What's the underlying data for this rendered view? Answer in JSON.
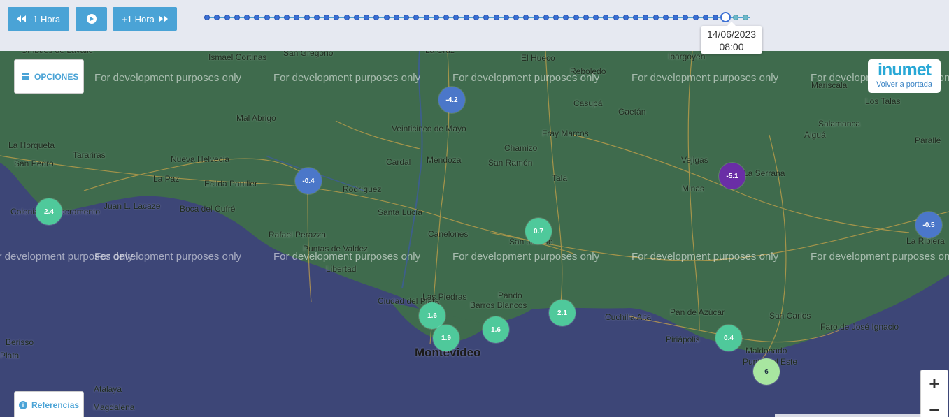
{
  "controls": {
    "prev_label": "-1 Hora",
    "next_label": "+1 Hora",
    "play_icon": "play-icon"
  },
  "timeline": {
    "date": "14/06/2023",
    "time": "08:00",
    "steps_total": 55,
    "current_step": 52
  },
  "menu": {
    "options_label": "OPCIONES",
    "references_label": "Referencias"
  },
  "logo": {
    "brand": "inumet",
    "link": "Volver a portada"
  },
  "zoom": {
    "in": "+",
    "out": "−"
  },
  "watermark": "For development purposes only",
  "colors": {
    "land": "#3f6b4d",
    "water": "#3d4677",
    "accent": "#4aa3d6",
    "marker_cold_blue": "#4b77c9",
    "marker_purple": "#6a2ea6",
    "marker_teal": "#4fc99b",
    "marker_lightgreen": "#a8e6a0"
  },
  "places": [
    {
      "name": "Ombúes de Lavalle"
    },
    {
      "name": "Ismael Cortinas"
    },
    {
      "name": "San Gregorio"
    },
    {
      "name": "La Cruz"
    },
    {
      "name": "El Hueco"
    },
    {
      "name": "Reboledo"
    },
    {
      "name": "Ibargoyen"
    },
    {
      "name": "Mariscala"
    },
    {
      "name": "Los Talas"
    },
    {
      "name": "Mal Abrigo"
    },
    {
      "name": "Casupá"
    },
    {
      "name": "Gaetán"
    },
    {
      "name": "Salamanca"
    },
    {
      "name": "Aiguá"
    },
    {
      "name": "Veinticinco de Mayo"
    },
    {
      "name": "La Horqueta"
    },
    {
      "name": "Tarariras"
    },
    {
      "name": "Nueva Helvecia"
    },
    {
      "name": "Chamizo"
    },
    {
      "name": "Fray Marcos"
    },
    {
      "name": "Parallé"
    },
    {
      "name": "San Pedro"
    },
    {
      "name": "Cardal"
    },
    {
      "name": "Mendoza"
    },
    {
      "name": "San Ramón"
    },
    {
      "name": "Vejigas"
    },
    {
      "name": "La Paz"
    },
    {
      "name": "Ecilda Paullier"
    },
    {
      "name": "Tala"
    },
    {
      "name": "La Serrana"
    },
    {
      "name": "Rodríguez"
    },
    {
      "name": "Minas"
    },
    {
      "name": "Juan L. Lacaze"
    },
    {
      "name": "Boca del Cufré"
    },
    {
      "name": "Santa Lucía"
    },
    {
      "name": "Colonia del Sacramento"
    },
    {
      "name": "Rafael Perazza"
    },
    {
      "name": "Canelones"
    },
    {
      "name": "San Jacinto"
    },
    {
      "name": "La Ribiera"
    },
    {
      "name": "Puntas de Valdez"
    },
    {
      "name": "Libertad"
    },
    {
      "name": "Las Piedras"
    },
    {
      "name": "Pando"
    },
    {
      "name": "Ciudad del Plata"
    },
    {
      "name": "Barros Blancos"
    },
    {
      "name": "Cuchilla Alta"
    },
    {
      "name": "Pan de Azúcar"
    },
    {
      "name": "San Carlos"
    },
    {
      "name": "Faro de José Ignacio"
    },
    {
      "name": "Piriápolis"
    },
    {
      "name": "Montevideo"
    },
    {
      "name": "Maldonado"
    },
    {
      "name": "Punta del Este"
    },
    {
      "name": "Berisso"
    },
    {
      "name": "Atalaya"
    },
    {
      "name": "Magdalena"
    },
    {
      "name": "Plata"
    }
  ],
  "markers": [
    {
      "value": "-4.2",
      "color": "blue"
    },
    {
      "value": "-0.4",
      "color": "blue"
    },
    {
      "value": "-5.1",
      "color": "purple"
    },
    {
      "value": "-0.5",
      "color": "blue"
    },
    {
      "value": "2.4",
      "color": "teal"
    },
    {
      "value": "0.7",
      "color": "teal"
    },
    {
      "value": "1.6",
      "color": "teal"
    },
    {
      "value": "1.9",
      "color": "teal"
    },
    {
      "value": "1.6",
      "color": "teal"
    },
    {
      "value": "2.1",
      "color": "teal"
    },
    {
      "value": "0.4",
      "color": "teal"
    },
    {
      "value": "6",
      "color": "lightgreen"
    }
  ]
}
